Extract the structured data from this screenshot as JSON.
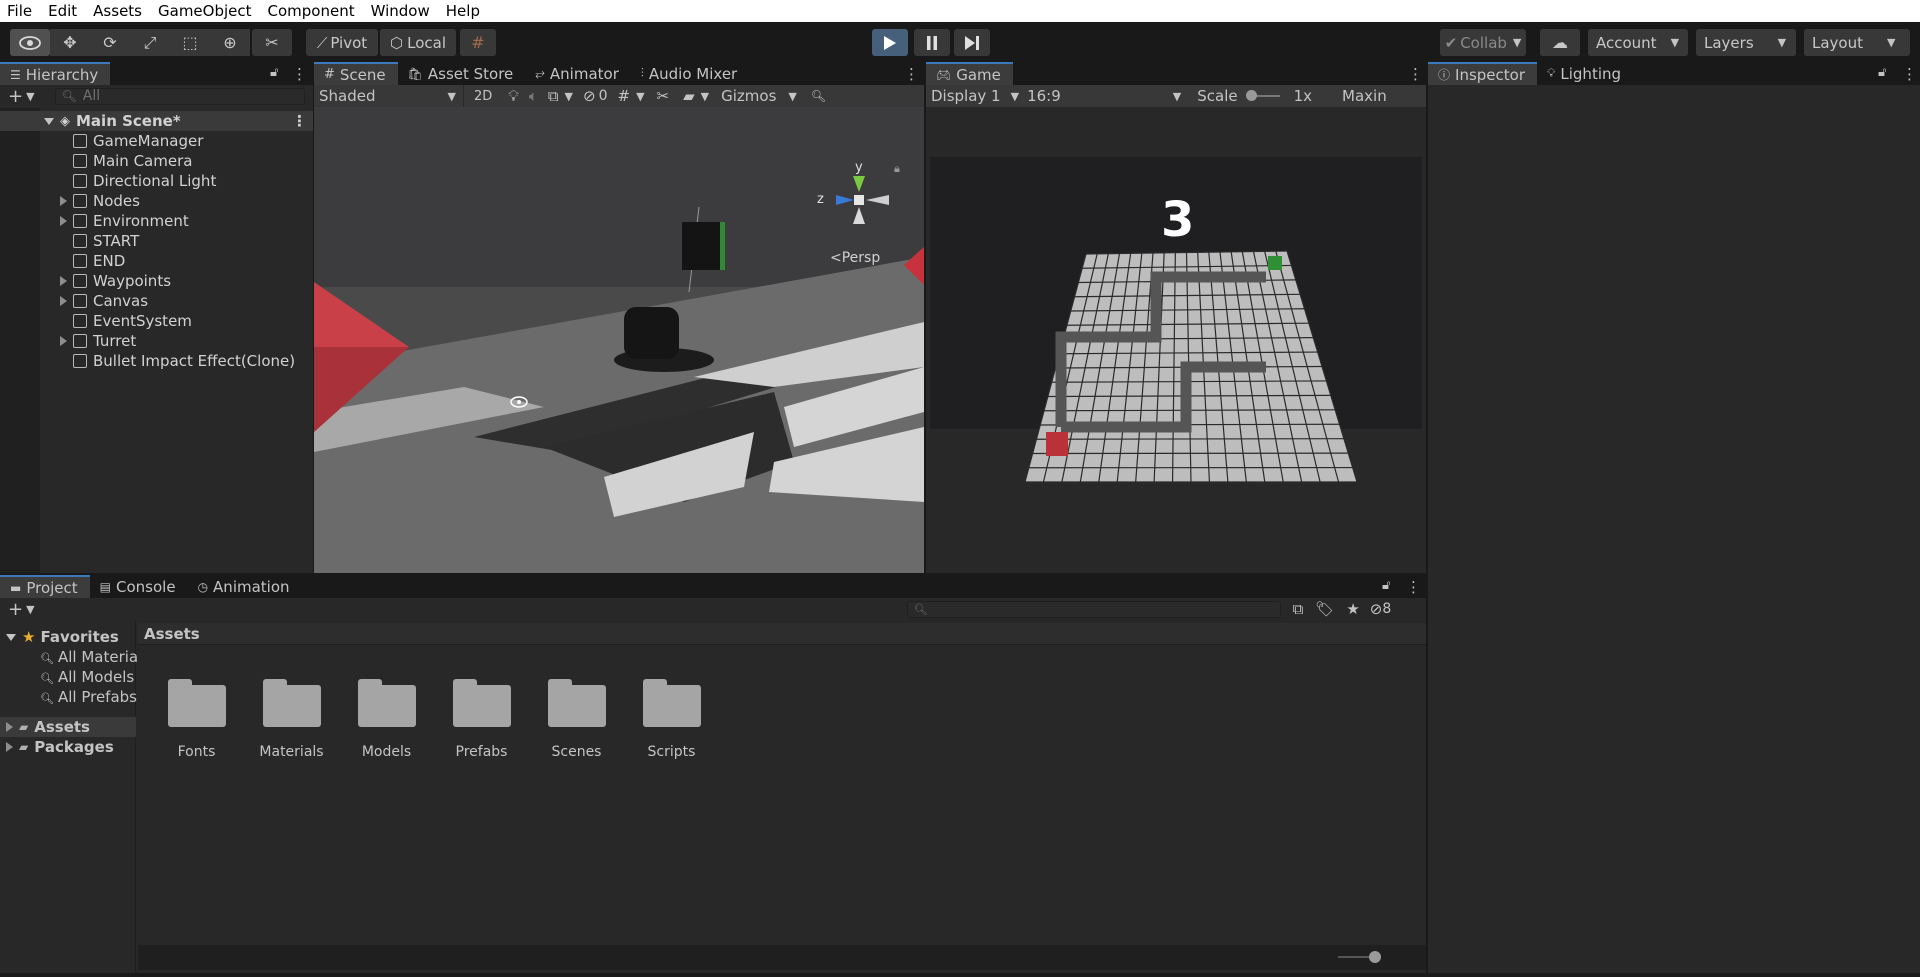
{
  "menu": [
    "File",
    "Edit",
    "Assets",
    "GameObject",
    "Component",
    "Window",
    "Help"
  ],
  "toolbar": {
    "pivot": "Pivot",
    "local": "Local",
    "collab": "Collab",
    "account": "Account",
    "layers": "Layers",
    "layout": "Layout"
  },
  "hierarchy": {
    "tab": "Hierarchy",
    "search_placeholder": "All",
    "scene_name": "Main Scene*",
    "items": [
      {
        "label": "GameManager",
        "fold": false
      },
      {
        "label": "Main Camera",
        "fold": false
      },
      {
        "label": "Directional Light",
        "fold": false
      },
      {
        "label": "Nodes",
        "fold": true
      },
      {
        "label": "Environment",
        "fold": true
      },
      {
        "label": "START",
        "fold": false
      },
      {
        "label": "END",
        "fold": false
      },
      {
        "label": "Waypoints",
        "fold": true
      },
      {
        "label": "Canvas",
        "fold": true
      },
      {
        "label": "EventSystem",
        "fold": false
      },
      {
        "label": "Turret",
        "fold": true
      },
      {
        "label": "Bullet Impact Effect(Clone)",
        "fold": false
      }
    ]
  },
  "scene": {
    "tabs": [
      "Scene",
      "Asset Store",
      "Animator",
      "Audio Mixer"
    ],
    "shading": "Shaded",
    "mode_2d": "2D",
    "hidden_count": "0",
    "gizmos": "Gizmos",
    "persp": "Persp",
    "axis_y": "y",
    "axis_z": "z"
  },
  "game": {
    "tab": "Game",
    "display": "Display 1",
    "aspect": "16:9",
    "scale_label": "Scale",
    "scale_value": "1x",
    "maximize": "Maxin",
    "countdown": "3"
  },
  "inspector": {
    "tabs": [
      "Inspector",
      "Lighting"
    ]
  },
  "project": {
    "tabs": [
      "Project",
      "Console",
      "Animation"
    ],
    "favorites": "Favorites",
    "favorite_items": [
      "All Materia",
      "All Models",
      "All Prefabs"
    ],
    "roots": [
      "Assets",
      "Packages"
    ],
    "breadcrumb": "Assets",
    "folders": [
      "Fonts",
      "Materials",
      "Models",
      "Prefabs",
      "Scenes",
      "Scripts"
    ],
    "hidden_packages": "8"
  },
  "colors": {
    "accent": "#3a79bb",
    "panel": "#282828",
    "play_active": "#46607c"
  }
}
